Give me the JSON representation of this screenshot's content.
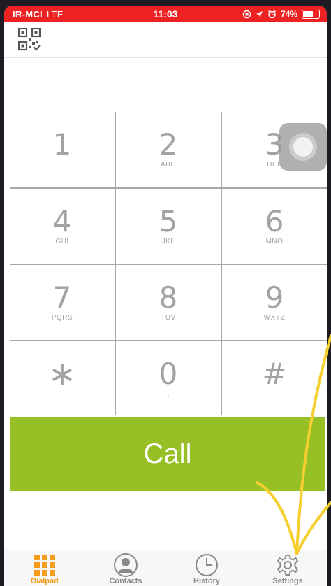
{
  "status_bar": {
    "carrier": "IR-MCI",
    "network": "LTE",
    "time": "11:03",
    "battery_label": "74%",
    "battery_level": 0.74,
    "icons": [
      "screen-rotation-lock-icon",
      "location-arrow-icon",
      "alarm-icon",
      "battery-icon"
    ],
    "color": "#ee2222"
  },
  "header": {
    "icons": [
      "qr-code-icon"
    ]
  },
  "keypad": {
    "keys": [
      {
        "digit": "1",
        "letters": ""
      },
      {
        "digit": "2",
        "letters": "ABC"
      },
      {
        "digit": "3",
        "letters": "DEF"
      },
      {
        "digit": "4",
        "letters": "GHI"
      },
      {
        "digit": "5",
        "letters": "JKL"
      },
      {
        "digit": "6",
        "letters": "MNO"
      },
      {
        "digit": "7",
        "letters": "PQRS"
      },
      {
        "digit": "8",
        "letters": "TUV"
      },
      {
        "digit": "9",
        "letters": "WXYZ"
      },
      {
        "digit": "∗",
        "letters": ""
      },
      {
        "digit": "0",
        "letters": "+"
      },
      {
        "digit": "#",
        "letters": ""
      }
    ]
  },
  "call_button": {
    "label": "Call",
    "color": "#97bf26"
  },
  "tabs": [
    {
      "label": "Dialpad",
      "icon": "dialpad-grid-icon",
      "active": true
    },
    {
      "label": "Contacts",
      "icon": "contact-person-icon",
      "active": false
    },
    {
      "label": "History",
      "icon": "clock-icon",
      "active": false
    },
    {
      "label": "Settings",
      "icon": "gear-icon",
      "active": false
    }
  ],
  "accent_color": "#f59c1a",
  "overlay": {
    "icons": [
      "assistive-touch-icon",
      "annotation-arrow-icon"
    ],
    "arrow_color": "#f5cf2e"
  }
}
